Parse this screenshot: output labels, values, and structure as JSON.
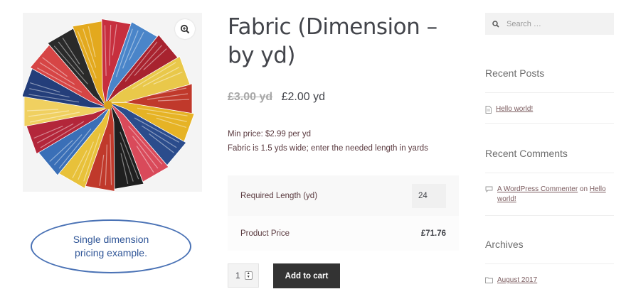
{
  "product": {
    "title": "Fabric (Dimension – by yd)",
    "price_old": "£3.00 yd",
    "price_new": "£2.00 yd",
    "min_price": "Min price: $2.99 per yd",
    "description": "Fabric is 1.5 yds wide; enter the needed length in yards",
    "required_length_label": "Required Length (yd)",
    "required_length_value": "24",
    "product_price_label": "Product Price",
    "product_price_value": "£71.76",
    "quantity": "1",
    "add_to_cart_label": "Add to cart"
  },
  "callout": {
    "line1": "Single dimension",
    "line2": "pricing example."
  },
  "sidebar": {
    "search_placeholder": "Search …",
    "recent_posts_title": "Recent Posts",
    "recent_posts": [
      {
        "label": "Hello world!"
      }
    ],
    "recent_comments_title": "Recent Comments",
    "recent_comment": {
      "author": "A WordPress Commenter",
      "on": "on",
      "post": "Hello world!"
    },
    "archives_title": "Archives",
    "archives": [
      {
        "label": "August 2017"
      }
    ]
  },
  "colors": {
    "callout_border": "#4a72b5",
    "button_bg": "#333333",
    "link": "#7a5a5d"
  },
  "icons": {
    "zoom": "magnifier-plus-icon",
    "search": "search-icon",
    "post": "document-icon",
    "comment": "comment-bubble-icon",
    "archive": "folder-icon"
  }
}
